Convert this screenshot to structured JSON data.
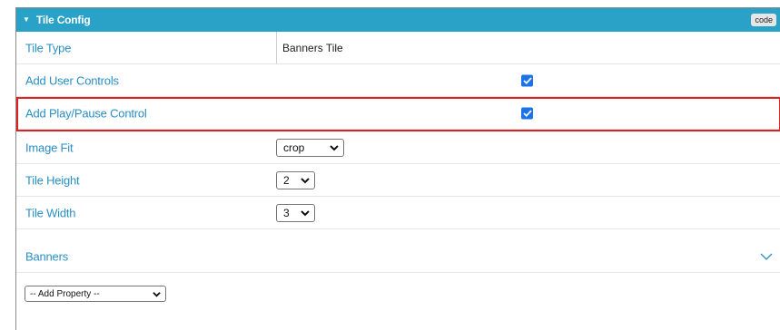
{
  "header": {
    "caret": "▼",
    "title": "Tile Config",
    "code_label": "code"
  },
  "rows": {
    "tile_type": {
      "label": "Tile Type",
      "value": "Banners Tile"
    },
    "add_user_controls": {
      "label": "Add User Controls",
      "checked": true
    },
    "add_play_pause": {
      "label": "Add Play/Pause Control",
      "checked": true
    },
    "image_fit": {
      "label": "Image Fit",
      "value": "crop"
    },
    "tile_height": {
      "label": "Tile Height",
      "value": "2"
    },
    "tile_width": {
      "label": "Tile Width",
      "value": "3"
    },
    "banners": {
      "label": "Banners"
    }
  },
  "add_property": {
    "value": "-- Add Property --"
  },
  "colors": {
    "header_bg": "#2aa2c8",
    "label_text": "#2a8fc3",
    "checkbox_bg": "#1a73e8",
    "highlight_border": "#e02020"
  }
}
